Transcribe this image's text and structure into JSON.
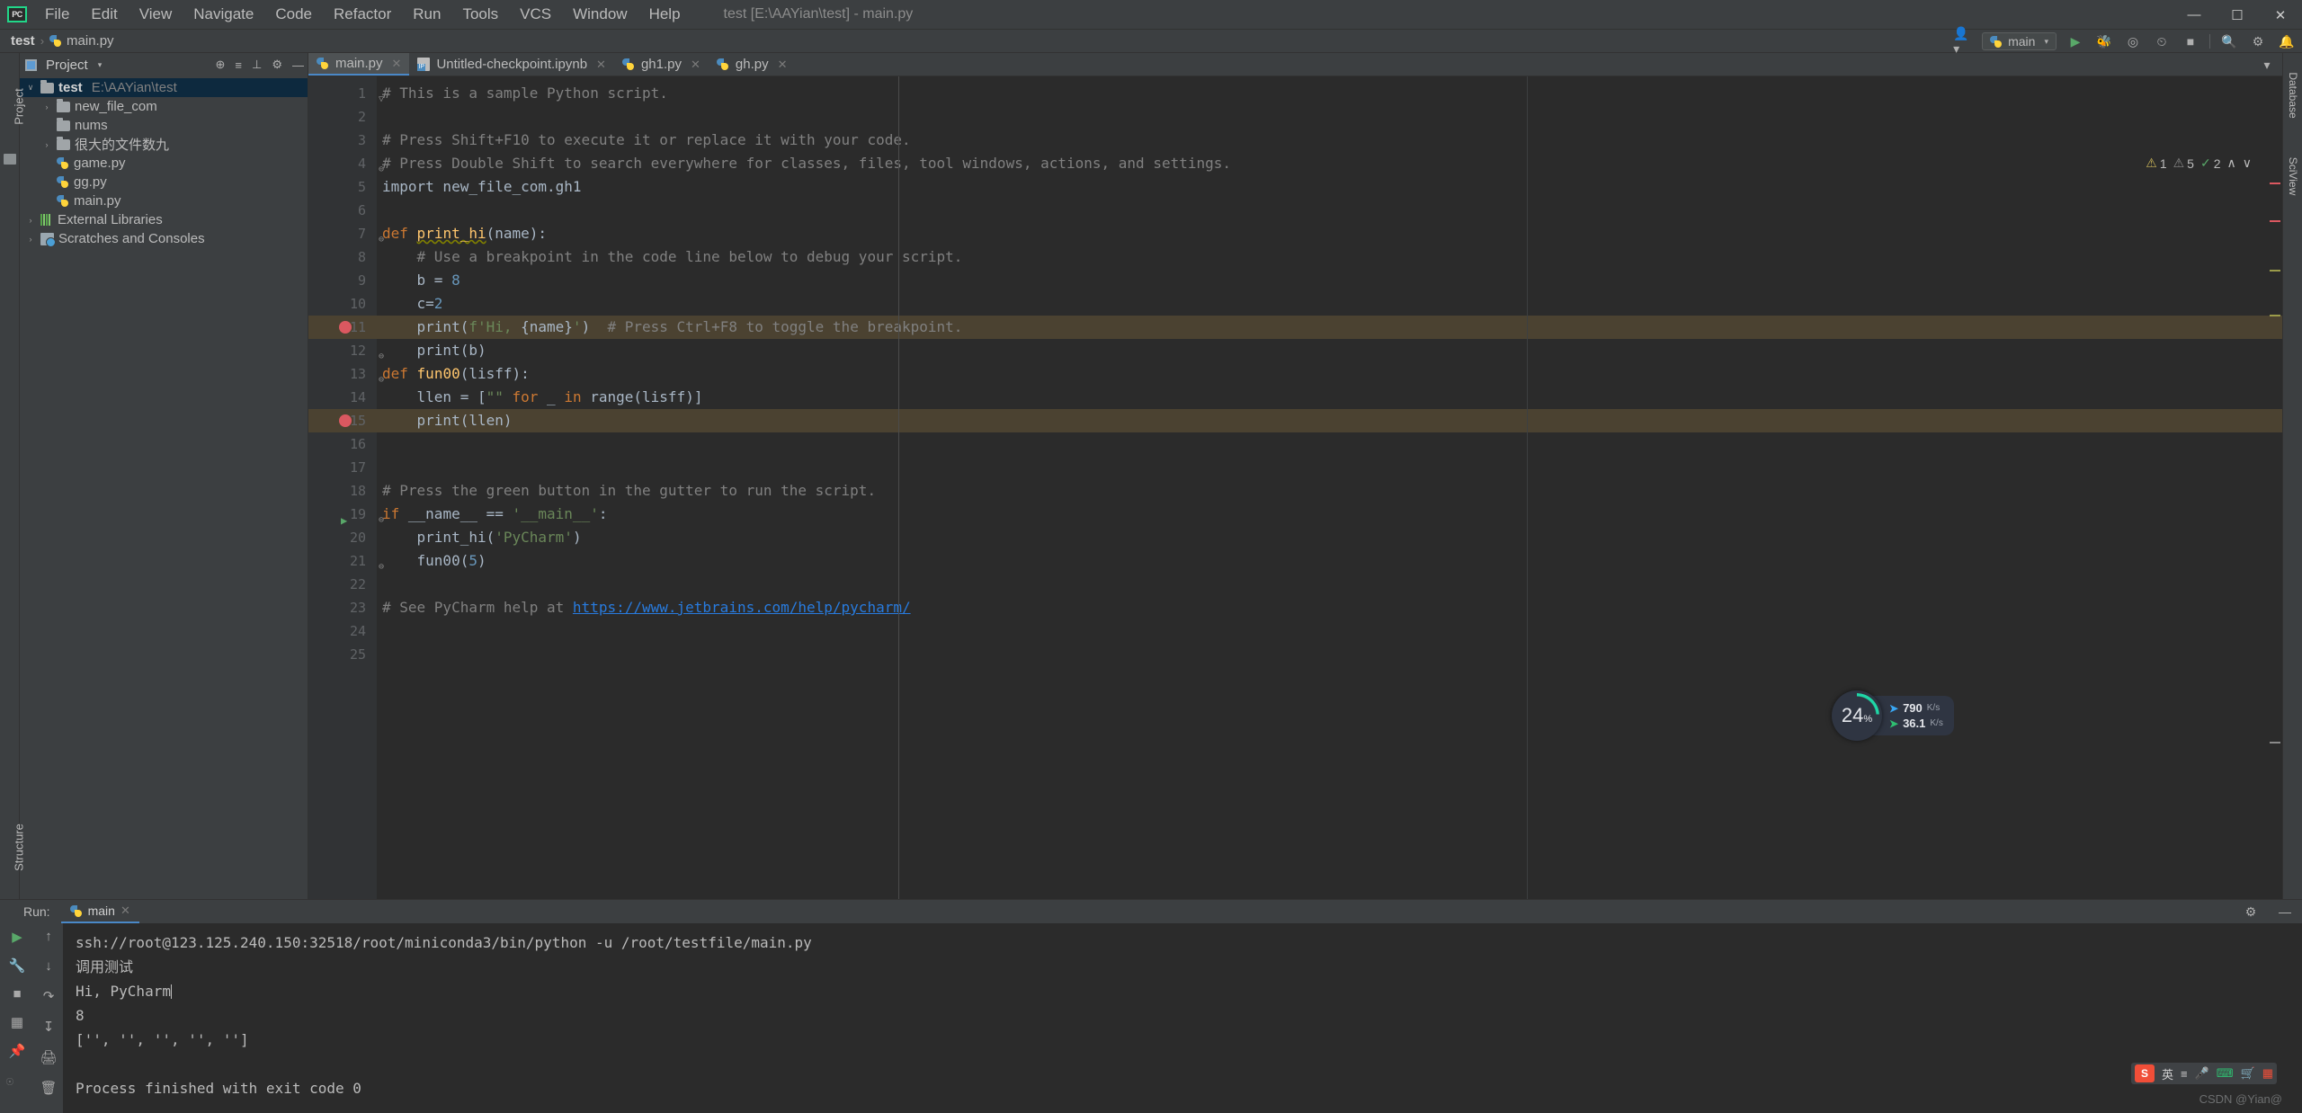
{
  "titlebar": {
    "logo": "PC",
    "menu": [
      "File",
      "Edit",
      "View",
      "Navigate",
      "Code",
      "Refactor",
      "Run",
      "Tools",
      "VCS",
      "Window",
      "Help"
    ],
    "window_title": "test [E:\\AAYian\\test] - main.py",
    "minimize": "—",
    "maximize": "☐",
    "close": "✕"
  },
  "navbar": {
    "crumbs": [
      "test",
      "main.py"
    ],
    "separator": "›",
    "run_config": "main",
    "icons": [
      "person-icon",
      "play-icon",
      "debug-icon",
      "coverage-icon",
      "profile-icon",
      "stop-icon",
      "search-icon",
      "settings-icon",
      "notifications-icon"
    ]
  },
  "project_panel": {
    "title": "Project",
    "tools": [
      "⊕",
      "≡",
      "⊥",
      "⚙",
      "—"
    ],
    "tree": [
      {
        "label": "test",
        "path": "E:\\AAYian\\test",
        "icon": "folder-icon",
        "arrow": "∨",
        "indent": 0,
        "selected": true,
        "bold": true
      },
      {
        "label": "new_file_com",
        "path": "",
        "icon": "folder-icon",
        "arrow": "›",
        "indent": 1,
        "selected": false,
        "bold": false
      },
      {
        "label": "nums",
        "path": "",
        "icon": "folder-icon",
        "arrow": "",
        "indent": 1,
        "selected": false,
        "bold": false
      },
      {
        "label": "很大的文件数九",
        "path": "",
        "icon": "folder-icon",
        "arrow": "›",
        "indent": 1,
        "selected": false,
        "bold": false
      },
      {
        "label": "game.py",
        "path": "",
        "icon": "python-file-icon",
        "arrow": "",
        "indent": 1,
        "selected": false,
        "bold": false
      },
      {
        "label": "gg.py",
        "path": "",
        "icon": "python-file-icon",
        "arrow": "",
        "indent": 1,
        "selected": false,
        "bold": false
      },
      {
        "label": "main.py",
        "path": "",
        "icon": "python-file-icon",
        "arrow": "",
        "indent": 1,
        "selected": false,
        "bold": false
      },
      {
        "label": "External Libraries",
        "path": "",
        "icon": "library-icon",
        "arrow": "›",
        "indent": 0,
        "selected": false,
        "bold": false
      },
      {
        "label": "Scratches and Consoles",
        "path": "",
        "icon": "scratches-icon",
        "arrow": "›",
        "indent": 0,
        "selected": false,
        "bold": false
      }
    ]
  },
  "left_strip": {
    "top_tab": "Project",
    "bottom_tab": "Structure"
  },
  "right_strip": {
    "tab1": "Database",
    "tab2": "SciView"
  },
  "editor": {
    "tabs": [
      {
        "label": "main.py",
        "icon": "python-file-icon",
        "active": true,
        "close": "✕"
      },
      {
        "label": "Untitled-checkpoint.ipynb",
        "icon": "jupyter-file-icon",
        "active": false,
        "close": "✕"
      },
      {
        "label": "gh1.py",
        "icon": "python-file-icon",
        "active": false,
        "close": "✕"
      },
      {
        "label": "gh.py",
        "icon": "python-file-icon",
        "active": false,
        "close": "✕"
      }
    ],
    "inspections": {
      "warnings": "1",
      "weak_warnings": "5",
      "typos": "2",
      "up": "∧",
      "down": "∨"
    },
    "lines": [
      {
        "n": "1",
        "html": "<span class=\"cmt\"># This is a sample Python script.</span>",
        "fold": "▽",
        "bp": false,
        "hl": false,
        "run": false
      },
      {
        "n": "2",
        "html": "",
        "fold": "",
        "bp": false,
        "hl": false,
        "run": false
      },
      {
        "n": "3",
        "html": "<span class=\"cmt\"># Press Shift+F10 to execute it or replace it with your code.</span>",
        "fold": "",
        "bp": false,
        "hl": false,
        "run": false
      },
      {
        "n": "4",
        "html": "<span class=\"cmt\"># Press Double Shift to search everywhere for classes, files, tool windows, actions, and settings.</span>",
        "fold": "⊖",
        "bp": false,
        "hl": false,
        "run": false
      },
      {
        "n": "5",
        "html": "<span class=\"plain\">import new_file_com.gh1</span>",
        "fold": "",
        "bp": false,
        "hl": false,
        "run": false
      },
      {
        "n": "6",
        "html": "",
        "fold": "",
        "bp": false,
        "hl": false,
        "run": false
      },
      {
        "n": "7",
        "html": "<span class=\"kw\">def</span> <span class=\"fn err-underline\">print_hi</span><span class=\"plain\">(name):</span>",
        "fold": "⊖",
        "bp": false,
        "hl": false,
        "run": false
      },
      {
        "n": "8",
        "html": "    <span class=\"cmt\"># Use a breakpoint in the code line below to debug your script.</span>",
        "fold": "",
        "bp": false,
        "hl": false,
        "run": false
      },
      {
        "n": "9",
        "html": "    <span class=\"plain\">b = </span><span class=\"num\">8</span>",
        "fold": "",
        "bp": false,
        "hl": false,
        "run": false
      },
      {
        "n": "10",
        "html": "    <span class=\"plain\">c=</span><span class=\"num\">2</span>",
        "fold": "",
        "bp": false,
        "hl": false,
        "run": false
      },
      {
        "n": "11",
        "html": "    <span class=\"plain\">print(</span><span class=\"str\">f'Hi, </span><span class=\"plain\">{name}</span><span class=\"str\">'</span><span class=\"plain\">)</span>  <span class=\"cmt\"># Press Ctrl+F8 to toggle the breakpoint.</span>",
        "fold": "",
        "bp": true,
        "hl": true,
        "run": false
      },
      {
        "n": "12",
        "html": "    <span class=\"plain\">print(b)</span>",
        "fold": "⊖",
        "bp": false,
        "hl": false,
        "run": false
      },
      {
        "n": "13",
        "html": "<span class=\"kw\">def</span> <span class=\"fn\">fun00</span><span class=\"plain\">(lisff):</span>",
        "fold": "⊖",
        "bp": false,
        "hl": false,
        "run": false
      },
      {
        "n": "14",
        "html": "    <span class=\"plain\">llen = [</span><span class=\"str\">\"\"</span> <span class=\"kw\">for</span> <span class=\"plain\">_</span> <span class=\"kw\">in</span> <span class=\"plain\">range(lisff)]</span>",
        "fold": "",
        "bp": false,
        "hl": false,
        "run": false
      },
      {
        "n": "15",
        "html": "    <span class=\"plain\">print(llen)</span>",
        "fold": "⊖",
        "bp": true,
        "hl": true,
        "run": false
      },
      {
        "n": "16",
        "html": "",
        "fold": "",
        "bp": false,
        "hl": false,
        "run": false
      },
      {
        "n": "17",
        "html": "",
        "fold": "",
        "bp": false,
        "hl": false,
        "run": false
      },
      {
        "n": "18",
        "html": "<span class=\"cmt\"># Press the green button in the gutter to run the script.</span>",
        "fold": "",
        "bp": false,
        "hl": false,
        "run": false
      },
      {
        "n": "19",
        "html": "<span class=\"kw\">if</span> <span class=\"plain\">__name__ == </span><span class=\"str\">'__main__'</span><span class=\"plain\">:</span>",
        "fold": "⊖",
        "bp": false,
        "hl": false,
        "run": true
      },
      {
        "n": "20",
        "html": "    <span class=\"plain\">print_hi(</span><span class=\"str\">'PyCharm'</span><span class=\"plain\">)</span>",
        "fold": "",
        "bp": false,
        "hl": false,
        "run": false
      },
      {
        "n": "21",
        "html": "    <span class=\"plain\">fun00(</span><span class=\"num\">5</span><span class=\"plain\">)</span>",
        "fold": "⊖",
        "bp": false,
        "hl": false,
        "run": false
      },
      {
        "n": "22",
        "html": "",
        "fold": "",
        "bp": false,
        "hl": false,
        "run": false
      },
      {
        "n": "23",
        "html": "<span class=\"cmt\"># See PyCharm help at </span><span class=\"lnk\">https://www.jetbrains.com/help/pycharm/</span>",
        "fold": "",
        "bp": false,
        "hl": false,
        "run": false
      },
      {
        "n": "24",
        "html": "",
        "fold": "",
        "bp": false,
        "hl": false,
        "run": false
      },
      {
        "n": "25",
        "html": "",
        "fold": "",
        "bp": false,
        "hl": false,
        "run": false
      }
    ]
  },
  "network_widget": {
    "percent": "24",
    "percent_unit": "%",
    "upload": "790",
    "upload_unit": "K/s",
    "download": "36.1",
    "download_unit": "K/s",
    "ring_color": "#1fd6a6"
  },
  "run_panel": {
    "label": "Run:",
    "tab": "main",
    "tab_close": "✕",
    "side_icons": [
      "rerun-icon",
      "settings-wrench-icon",
      "stop-icon",
      "layout-icon",
      "pin-icon"
    ],
    "side_icons2": [
      "scroll-up-icon",
      "scroll-down-icon",
      "soft-wrap-icon",
      "scroll-to-end-icon",
      "print-icon",
      "trash-icon"
    ],
    "console": [
      "ssh://root@123.125.240.150:32518/root/miniconda3/bin/python -u /root/testfile/main.py",
      "调用测试",
      "Hi, PyCharm",
      "8",
      "['', '', '', '', '']",
      "",
      "Process finished with exit code 0"
    ],
    "header_icons": [
      "gear-icon",
      "minimize-icon"
    ]
  },
  "ime_tray": {
    "logo": "S",
    "items": [
      "英",
      "≡",
      "mic-icon",
      "keyboard-icon",
      "cart-icon",
      "grid-icon"
    ]
  },
  "watermark": "CSDN @Yian@"
}
